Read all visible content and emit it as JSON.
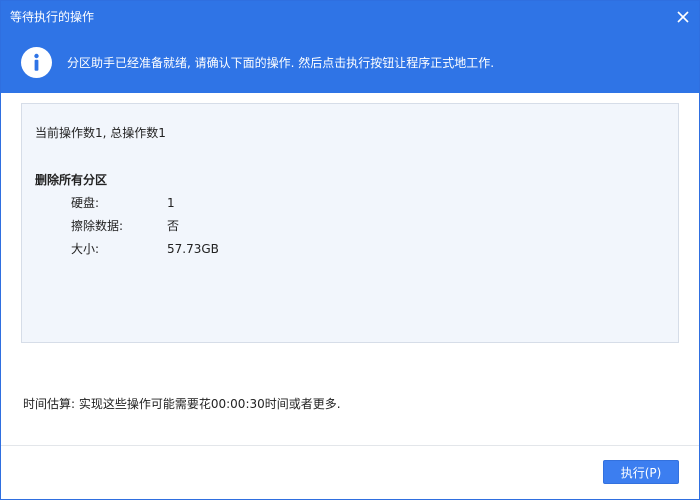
{
  "window": {
    "title": "等待执行的操作",
    "close_icon": "close-icon"
  },
  "banner": {
    "icon": "info-icon",
    "message": "分区助手已经准备就绪, 请确认下面的操作. 然后点击执行按钮让程序正式地工作.",
    "background_color": "#2f74e6"
  },
  "operations": {
    "summary": "当前操作数1, 总操作数1",
    "items": [
      {
        "title": "删除所有分区",
        "details": [
          {
            "label": "硬盘:",
            "value": "1"
          },
          {
            "label": "擦除数据:",
            "value": "否"
          },
          {
            "label": "大小:",
            "value": "57.73GB"
          }
        ]
      }
    ]
  },
  "footer": {
    "time_estimate": "时间估算: 实现这些操作可能需要花00:00:30时间或者更多.",
    "execute_label": "执行(P)",
    "accent_color": "#3c7ef0"
  }
}
